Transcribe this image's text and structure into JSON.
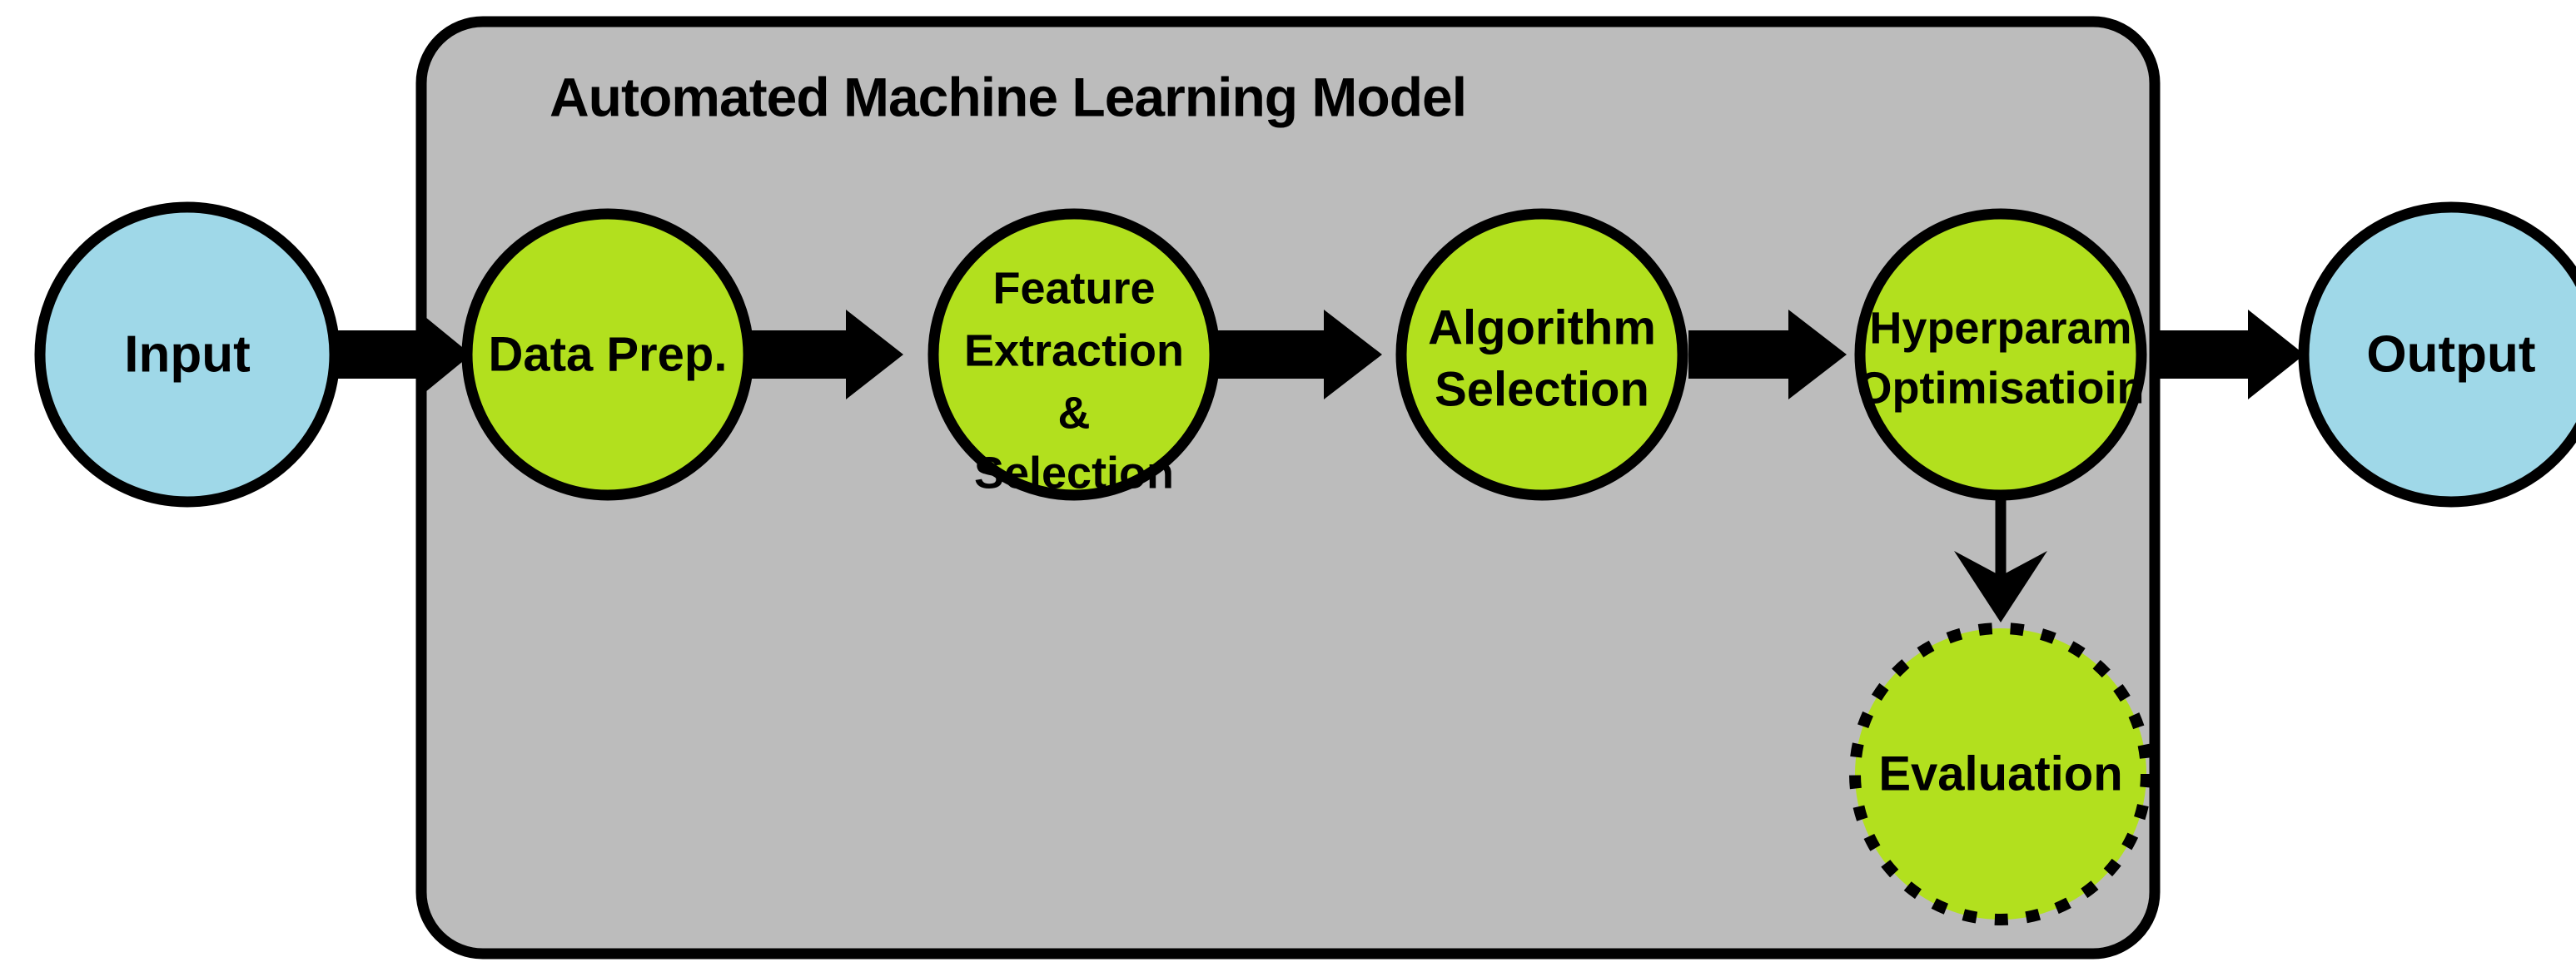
{
  "diagram": {
    "type": "flowchart",
    "title": "Automated Machine Learning Model",
    "colors": {
      "container_fill": "#BCBCBC",
      "container_stroke": "#000000",
      "process_fill": "#B2E01E",
      "terminal_fill": "#9FD8E8",
      "stroke": "#000000",
      "canvas": "#FFFFFF"
    },
    "container": {
      "label": "Automated Machine Learning Model"
    },
    "nodes": {
      "input": {
        "label": "Input",
        "kind": "terminal",
        "shape": "circle",
        "border": "solid"
      },
      "data_prep": {
        "label": "Data Prep.",
        "kind": "process",
        "shape": "circle",
        "border": "solid"
      },
      "feature": {
        "kind": "process",
        "shape": "circle",
        "border": "solid",
        "line1": "Feature",
        "line2": "Extraction",
        "line3": "&",
        "line4": "Selection"
      },
      "algorithm": {
        "kind": "process",
        "shape": "circle",
        "border": "solid",
        "line1": "Algorithm",
        "line2": "Selection"
      },
      "hyperparam": {
        "kind": "process",
        "shape": "circle",
        "border": "solid",
        "line1": "Hyperparam",
        "line2": "Optimisatioin"
      },
      "evaluation": {
        "label": "Evaluation",
        "kind": "process",
        "shape": "circle",
        "border": "dotted"
      },
      "output": {
        "label": "Output",
        "kind": "terminal",
        "shape": "circle",
        "border": "solid"
      }
    },
    "edges": [
      {
        "from": "input",
        "to": "data_prep",
        "style": "block-arrow",
        "direction": "right"
      },
      {
        "from": "data_prep",
        "to": "feature",
        "style": "block-arrow",
        "direction": "right"
      },
      {
        "from": "feature",
        "to": "algorithm",
        "style": "block-arrow",
        "direction": "right"
      },
      {
        "from": "algorithm",
        "to": "hyperparam",
        "style": "block-arrow",
        "direction": "right"
      },
      {
        "from": "hyperparam",
        "to": "output",
        "style": "block-arrow",
        "direction": "right"
      },
      {
        "from": "hyperparam",
        "to": "evaluation",
        "style": "thin-arrow",
        "direction": "down"
      }
    ]
  }
}
